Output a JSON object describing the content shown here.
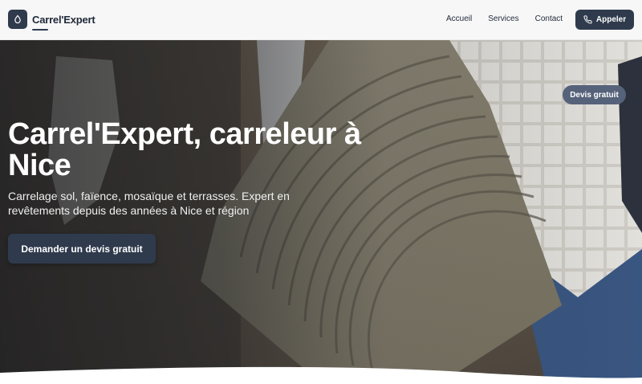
{
  "header": {
    "brand_name": "Carrel'Expert",
    "logo_icon": "water-drop-icon",
    "nav": [
      {
        "label": "Accueil"
      },
      {
        "label": "Services"
      },
      {
        "label": "Contact"
      }
    ],
    "call_button": {
      "label": "Appeler",
      "icon": "phone-icon"
    }
  },
  "hero": {
    "title": "Carrel'Expert, carreleur à Nice",
    "subtitle": "Carrelage sol, faïence, mosaïque et terrasses. Expert en revêtements depuis des années à Nice et région",
    "cta_label": "Demander un devis gratuit",
    "badge_label": "Devis gratuit"
  },
  "colors": {
    "primary": "#2f3b4d",
    "badge": "#55627a",
    "header_bg": "#f7f7f8",
    "text_dark": "#1f2937"
  }
}
